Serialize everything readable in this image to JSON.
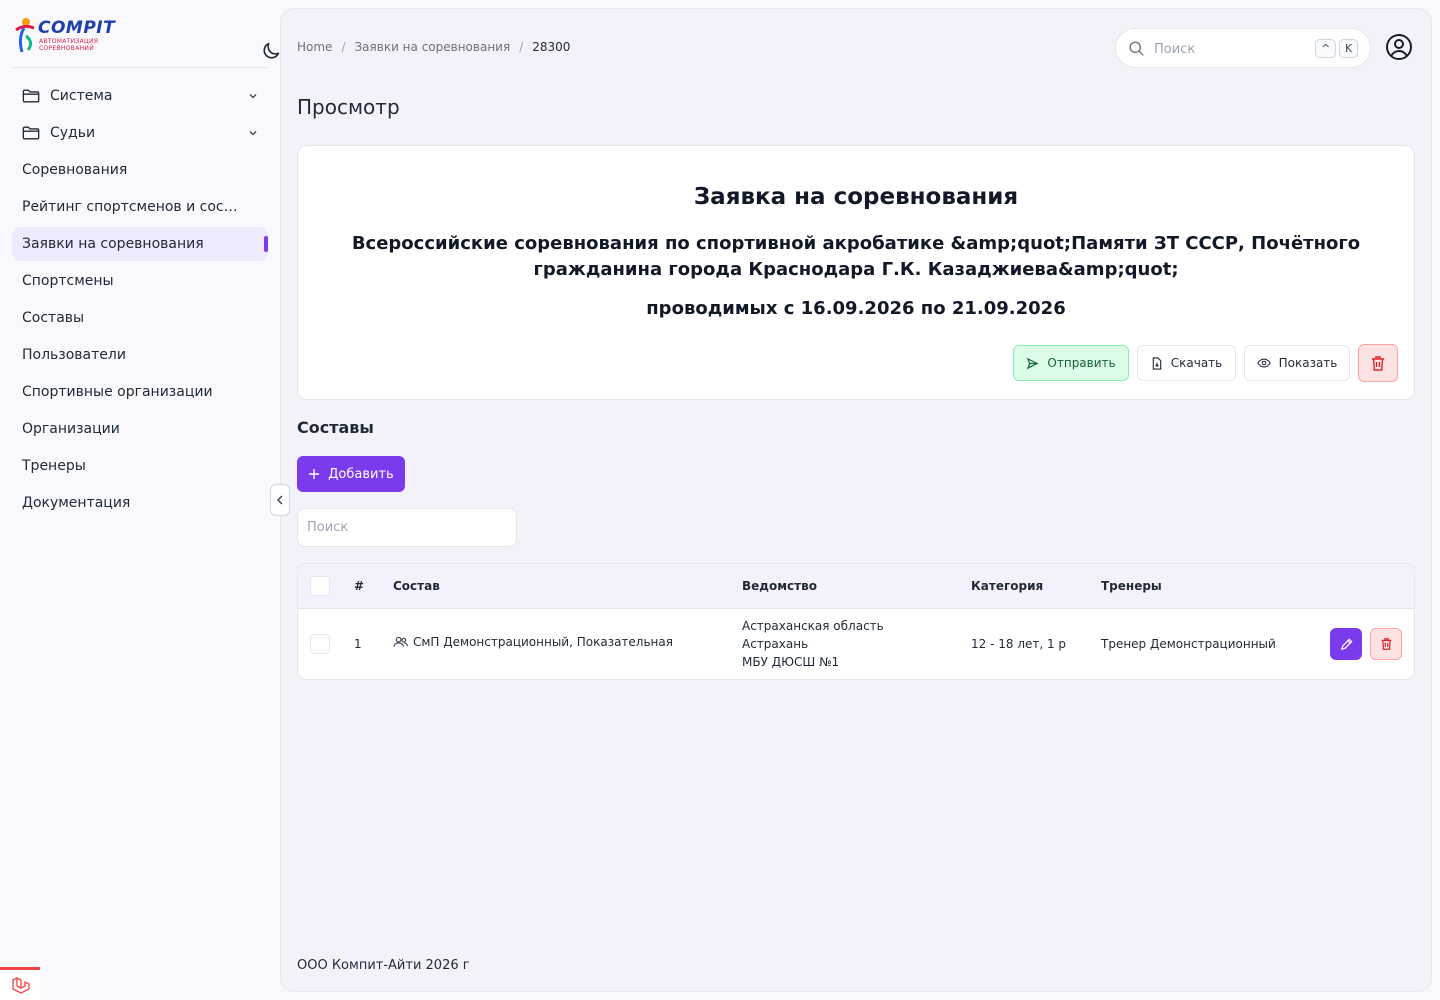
{
  "logo": {
    "title": "COMPIT",
    "subtitle_line1": "АВТОМАТИЗАЦИЯ",
    "subtitle_line2": "СОРЕВНОВАНИЙ"
  },
  "sidebar": {
    "items": [
      {
        "label": "Система",
        "expandable": true
      },
      {
        "label": "Судьи",
        "expandable": true
      },
      {
        "label": "Соревнования"
      },
      {
        "label": "Рейтинг спортсменов и составов"
      },
      {
        "label": "Заявки на соревнования",
        "active": true
      },
      {
        "label": "Спортсмены"
      },
      {
        "label": "Составы"
      },
      {
        "label": "Пользователи"
      },
      {
        "label": "Спортивные организации"
      },
      {
        "label": "Организации"
      },
      {
        "label": "Тренеры"
      },
      {
        "label": "Документация"
      }
    ]
  },
  "breadcrumb": {
    "home": "Home",
    "section": "Заявки на соревнования",
    "current": "28300"
  },
  "search": {
    "placeholder": "Поиск",
    "kbd1": "^",
    "kbd2": "K"
  },
  "page": {
    "title": "Просмотр"
  },
  "card": {
    "title": "Заявка на соревнования",
    "competition": "Всероссийские соревнования по спортивной акробатике &amp;quot;Памяти ЗТ СССР, Почётного гражданина города Краснодара Г.К. Казаджиева&amp;quot;",
    "dates": "проводимых с 16.09.2026 по 21.09.2026",
    "buttons": {
      "send": "Отправить",
      "download": "Скачать",
      "show": "Показать"
    }
  },
  "compositions": {
    "title": "Составы",
    "add_label": "Добавить",
    "search_placeholder": "Поиск",
    "columns": {
      "num": "#",
      "composition": "Состав",
      "department": "Ведомство",
      "category": "Категория",
      "coaches": "Тренеры"
    },
    "rows": [
      {
        "num": "1",
        "composition": "СмП Демонстрационный, Показательная",
        "department_line1": "Астраханская область",
        "department_line2": "Астрахань",
        "department_line3": "МБУ ДЮСШ №1",
        "category": "12 - 18 лет, 1 р",
        "coaches": "Тренер Демонстрационный"
      }
    ]
  },
  "footer": {
    "text": "ООО Компит-Айти 2026 г"
  },
  "colors": {
    "accent": "#7c3aed",
    "active_bg": "#ede9fe",
    "send_bg": "#dcfce7",
    "delete_bg": "#fde2e4"
  }
}
